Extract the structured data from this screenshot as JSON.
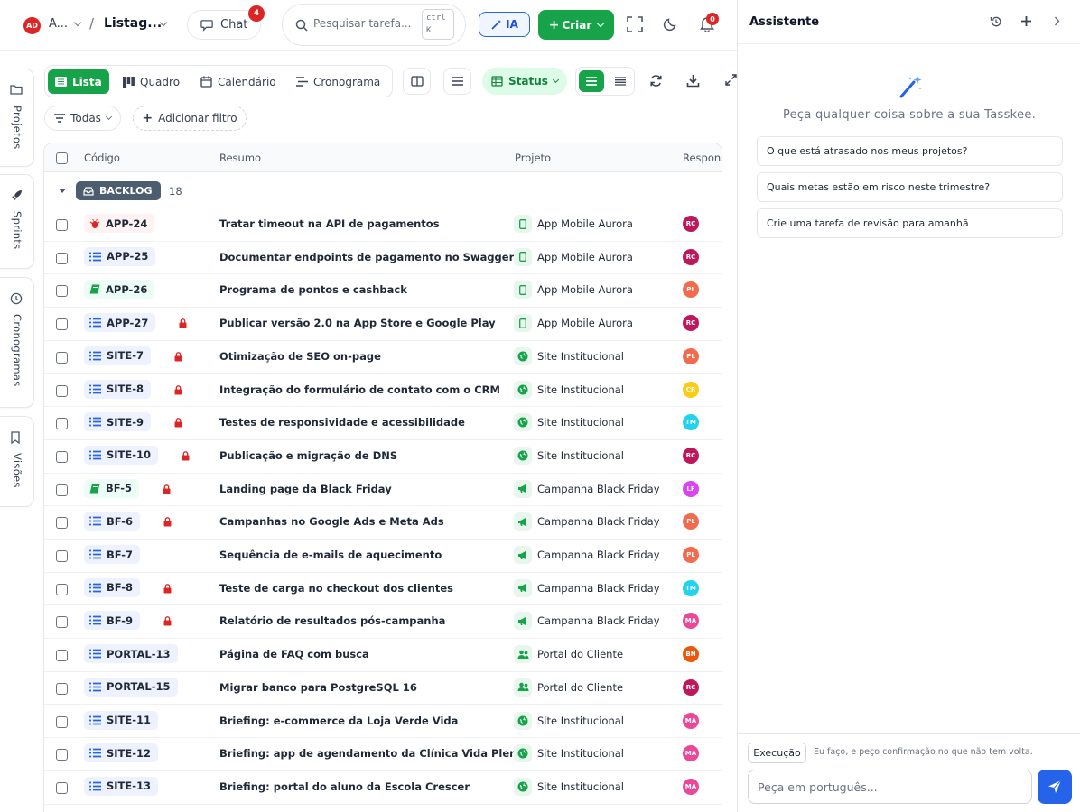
{
  "topbar": {
    "avatar": "AD",
    "workspace": "A...",
    "separator": "/",
    "page_title": "Listag...",
    "chat_label": "Chat",
    "chat_count": "4",
    "search_placeholder": "Pesquisar tarefa...",
    "shortcut_line1": "ctrl",
    "shortcut_line2": "K",
    "ia_label": "IA",
    "create_label": "Criar",
    "notifications_count": "0"
  },
  "rail": {
    "items": [
      {
        "label": "Projetos",
        "icon": "folder-icon"
      },
      {
        "label": "Sprints",
        "icon": "rocket-icon"
      },
      {
        "label": "Cronogramas",
        "icon": "clock-icon"
      },
      {
        "label": "Visões",
        "icon": "bookmark-icon"
      }
    ]
  },
  "views": {
    "tabs": [
      {
        "label": "Lista",
        "icon": "list-icon",
        "active": true
      },
      {
        "label": "Quadro",
        "icon": "board-icon",
        "active": false
      },
      {
        "label": "Calendário",
        "icon": "calendar-icon",
        "active": false
      },
      {
        "label": "Cronograma",
        "icon": "timeline-icon",
        "active": false
      }
    ],
    "status_label": "Status"
  },
  "filters": {
    "scope_label": "Todas",
    "add_filter_label": "Adicionar filtro"
  },
  "table": {
    "columns": {
      "code": "Código",
      "summary": "Resumo",
      "project": "Projeto",
      "responsible": "Respons"
    },
    "group": {
      "name": "BACKLOG",
      "count": "18"
    },
    "rows": [
      {
        "code": "APP-24",
        "type": "bug",
        "locked": false,
        "summary": "Tratar timeout na API de pagamentos",
        "project": "App Mobile Aurora",
        "project_icon": "mobile-icon",
        "resp": "RC",
        "resp_color": "#be185d"
      },
      {
        "code": "APP-25",
        "type": "task",
        "locked": false,
        "summary": "Documentar endpoints de pagamento no Swagger",
        "project": "App Mobile Aurora",
        "project_icon": "mobile-icon",
        "resp": "RC",
        "resp_color": "#be185d"
      },
      {
        "code": "APP-26",
        "type": "story",
        "locked": false,
        "summary": "Programa de pontos e cashback",
        "project": "App Mobile Aurora",
        "project_icon": "mobile-icon",
        "resp": "PL",
        "resp_color": "#f26b4f"
      },
      {
        "code": "APP-27",
        "type": "task",
        "locked": true,
        "summary": "Publicar versão 2.0 na App Store e Google Play",
        "project": "App Mobile Aurora",
        "project_icon": "mobile-icon",
        "resp": "RC",
        "resp_color": "#be185d"
      },
      {
        "code": "SITE-7",
        "type": "task",
        "locked": true,
        "summary": "Otimização de SEO on-page",
        "project": "Site Institucional",
        "project_icon": "globe-icon",
        "resp": "PL",
        "resp_color": "#f26b4f"
      },
      {
        "code": "SITE-8",
        "type": "task",
        "locked": true,
        "summary": "Integração do formulário de contato com o CRM",
        "project": "Site Institucional",
        "project_icon": "globe-icon",
        "resp": "CR",
        "resp_color": "#facc15"
      },
      {
        "code": "SITE-9",
        "type": "task",
        "locked": true,
        "summary": "Testes de responsividade e acessibilidade",
        "project": "Site Institucional",
        "project_icon": "globe-icon",
        "resp": "TM",
        "resp_color": "#22d3ee"
      },
      {
        "code": "SITE-10",
        "type": "task",
        "locked": true,
        "summary": "Publicação e migração de DNS",
        "project": "Site Institucional",
        "project_icon": "globe-icon",
        "resp": "RC",
        "resp_color": "#be185d"
      },
      {
        "code": "BF-5",
        "type": "story",
        "locked": true,
        "summary": "Landing page da Black Friday",
        "project": "Campanha Black Friday",
        "project_icon": "megaphone-icon",
        "resp": "LF",
        "resp_color": "#d946ef"
      },
      {
        "code": "BF-6",
        "type": "task",
        "locked": true,
        "summary": "Campanhas no Google Ads e Meta Ads",
        "project": "Campanha Black Friday",
        "project_icon": "megaphone-icon",
        "resp": "PL",
        "resp_color": "#f26b4f"
      },
      {
        "code": "BF-7",
        "type": "task",
        "locked": false,
        "summary": "Sequência de e-mails de aquecimento",
        "project": "Campanha Black Friday",
        "project_icon": "megaphone-icon",
        "resp": "PL",
        "resp_color": "#f26b4f"
      },
      {
        "code": "BF-8",
        "type": "task",
        "locked": true,
        "summary": "Teste de carga no checkout dos clientes",
        "project": "Campanha Black Friday",
        "project_icon": "megaphone-icon",
        "resp": "TM",
        "resp_color": "#22d3ee"
      },
      {
        "code": "BF-9",
        "type": "task",
        "locked": true,
        "summary": "Relatório de resultados pós-campanha",
        "project": "Campanha Black Friday",
        "project_icon": "megaphone-icon",
        "resp": "MA",
        "resp_color": "#ec4899"
      },
      {
        "code": "PORTAL-13",
        "type": "task",
        "locked": false,
        "summary": "Página de FAQ com busca",
        "project": "Portal do Cliente",
        "project_icon": "users-icon",
        "resp": "BN",
        "resp_color": "#ea580c"
      },
      {
        "code": "PORTAL-15",
        "type": "task",
        "locked": false,
        "summary": "Migrar banco para PostgreSQL 16",
        "project": "Portal do Cliente",
        "project_icon": "users-icon",
        "resp": "RC",
        "resp_color": "#be185d"
      },
      {
        "code": "SITE-11",
        "type": "task",
        "locked": false,
        "summary": "Briefing: e-commerce da Loja Verde Vida",
        "project": "Site Institucional",
        "project_icon": "globe-icon",
        "resp": "MA",
        "resp_color": "#ec4899"
      },
      {
        "code": "SITE-12",
        "type": "task",
        "locked": false,
        "summary": "Briefing: app de agendamento da Clínica Vida Plena",
        "project": "Site Institucional",
        "project_icon": "globe-icon",
        "resp": "MA",
        "resp_color": "#ec4899"
      },
      {
        "code": "SITE-13",
        "type": "task",
        "locked": false,
        "summary": "Briefing: portal do aluno da Escola Crescer",
        "project": "Site Institucional",
        "project_icon": "globe-icon",
        "resp": "MA",
        "resp_color": "#ec4899"
      }
    ]
  },
  "assistant": {
    "title": "Assistente",
    "hint": "Peça qualquer coisa sobre a sua Tasskee.",
    "suggestions": [
      "O que está atrasado nos meus projetos?",
      "Quais metas estão em risco neste trimestre?",
      "Crie uma tarefa de revisão para amanhã"
    ],
    "mode_label": "Execução",
    "mode_note": "Eu faço, e peço confirmação no que não tem volta.",
    "input_placeholder": "Peça em português..."
  },
  "colors": {
    "accent_green": "#16a34a",
    "accent_blue": "#2563eb",
    "danger": "#dc2626"
  }
}
